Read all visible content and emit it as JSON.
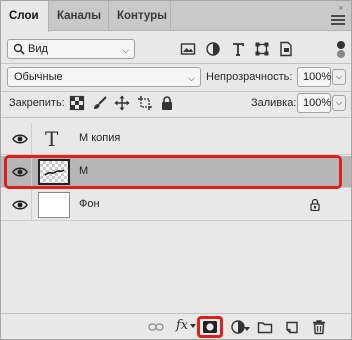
{
  "tabs": [
    {
      "label": "Слои"
    },
    {
      "label": "Каналы"
    },
    {
      "label": "Контуры"
    }
  ],
  "filter": {
    "kind_label": "Вид"
  },
  "blend": {
    "mode": "Обычные",
    "opacity_label": "Непрозрачность:",
    "opacity_value": "100%"
  },
  "lock": {
    "label": "Закрепить:",
    "fill_label": "Заливка:",
    "fill_value": "100%"
  },
  "layers": [
    {
      "name": "М копия",
      "type": "text",
      "visible": true,
      "selected": false
    },
    {
      "name": "М",
      "type": "raster",
      "visible": true,
      "selected": true
    },
    {
      "name": "Фон",
      "type": "background",
      "visible": true,
      "selected": false,
      "locked": true
    }
  ],
  "colors": {
    "highlight": "#e0201b",
    "selected_row": "#b6b6b6"
  },
  "icons": {
    "filter": [
      "image-filter-icon",
      "adjustment-filter-icon",
      "type-filter-icon",
      "shape-filter-icon",
      "smart-object-filter-icon"
    ],
    "lock": [
      "lock-transparent-icon",
      "lock-pixels-icon",
      "lock-position-icon",
      "lock-artboard-icon",
      "lock-all-icon"
    ],
    "bottom": [
      "link-layers-icon",
      "fx-icon",
      "add-mask-icon",
      "adjustment-layer-icon",
      "group-folder-icon",
      "new-layer-icon",
      "delete-icon"
    ]
  }
}
